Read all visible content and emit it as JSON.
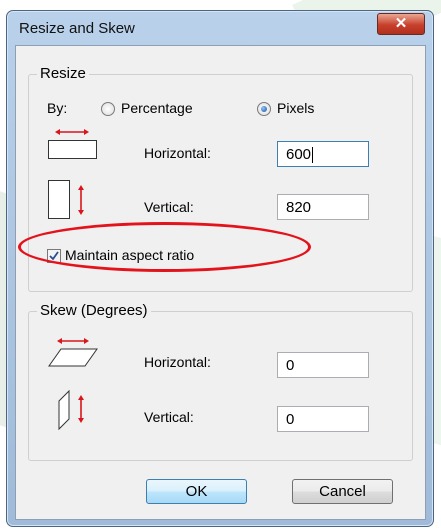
{
  "window": {
    "title": "Resize and Skew",
    "close_glyph": "✕"
  },
  "resize": {
    "group_label": "Resize",
    "by_label": "By:",
    "percentage_label": "Percentage",
    "pixels_label": "Pixels",
    "selected_mode": "Pixels",
    "horizontal_label": "Horizontal:",
    "horizontal_value": "600",
    "vertical_label": "Vertical:",
    "vertical_value": "820",
    "maintain_aspect_label": "Maintain aspect ratio",
    "maintain_aspect_checked": true
  },
  "skew": {
    "group_label": "Skew (Degrees)",
    "horizontal_label": "Horizontal:",
    "horizontal_value": "0",
    "vertical_label": "Vertical:",
    "vertical_value": "0"
  },
  "buttons": {
    "ok_label": "OK",
    "cancel_label": "Cancel"
  },
  "colors": {
    "annotation_red": "#e3121b",
    "arrow_red": "#d8161c"
  },
  "icons": [
    "resize-horizontal-icon",
    "resize-vertical-icon",
    "skew-horizontal-icon",
    "skew-vertical-icon",
    "checkmark-icon"
  ]
}
